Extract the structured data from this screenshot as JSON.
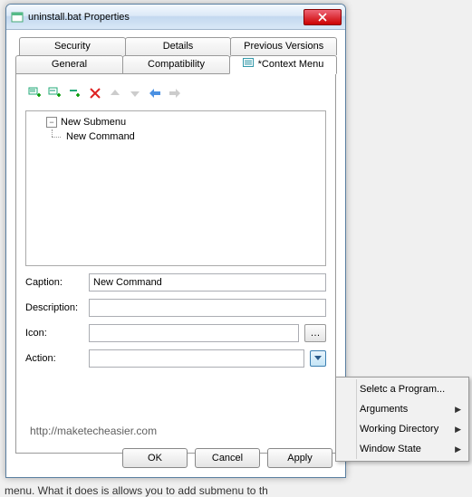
{
  "titlebar": {
    "title": "uninstall.bat Properties"
  },
  "tabs": {
    "row1": [
      {
        "label": "Security"
      },
      {
        "label": "Details"
      },
      {
        "label": "Previous Versions"
      }
    ],
    "row2": [
      {
        "label": "General"
      },
      {
        "label": "Compatibility"
      },
      {
        "label": "*Context Menu",
        "active": true
      }
    ]
  },
  "tree": {
    "root": "New Submenu",
    "child": "New Command"
  },
  "fields": {
    "caption": {
      "label": "Caption:",
      "value": "New Command"
    },
    "description": {
      "label": "Description:",
      "value": ""
    },
    "icon": {
      "label": "Icon:",
      "value": ""
    },
    "action": {
      "label": "Action:",
      "value": ""
    }
  },
  "watermark": "http://maketecheasier.com",
  "buttons": {
    "ok": "OK",
    "cancel": "Cancel",
    "apply": "Apply"
  },
  "menu": {
    "items": [
      {
        "label": "Seletc a Program...",
        "submenu": false
      },
      {
        "label": "Arguments",
        "submenu": true
      },
      {
        "label": "Working Directory",
        "submenu": true
      },
      {
        "label": "Window State",
        "submenu": true
      }
    ]
  },
  "bg_text": "menu. What it does is allows you to add submenu to th"
}
